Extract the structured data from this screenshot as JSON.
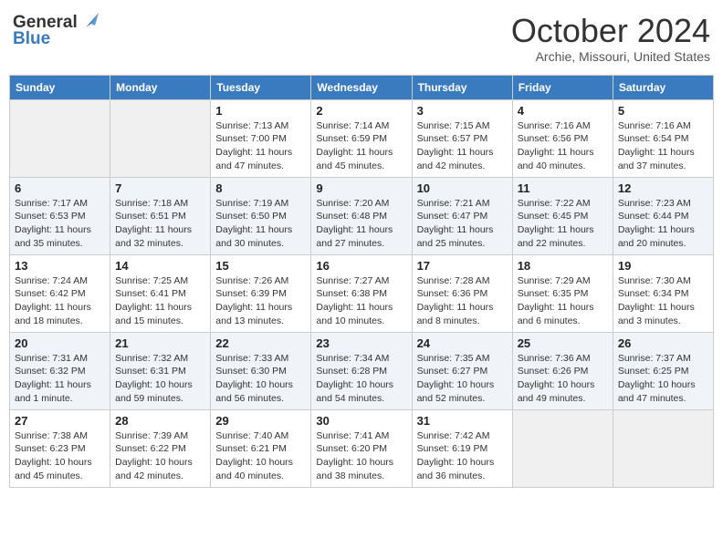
{
  "header": {
    "logo_general": "General",
    "logo_blue": "Blue",
    "month_title": "October 2024",
    "location": "Archie, Missouri, United States"
  },
  "days_of_week": [
    "Sunday",
    "Monday",
    "Tuesday",
    "Wednesday",
    "Thursday",
    "Friday",
    "Saturday"
  ],
  "weeks": [
    [
      {
        "day": "",
        "sunrise": "",
        "sunset": "",
        "daylight": ""
      },
      {
        "day": "",
        "sunrise": "",
        "sunset": "",
        "daylight": ""
      },
      {
        "day": "1",
        "sunrise": "Sunrise: 7:13 AM",
        "sunset": "Sunset: 7:00 PM",
        "daylight": "Daylight: 11 hours and 47 minutes."
      },
      {
        "day": "2",
        "sunrise": "Sunrise: 7:14 AM",
        "sunset": "Sunset: 6:59 PM",
        "daylight": "Daylight: 11 hours and 45 minutes."
      },
      {
        "day": "3",
        "sunrise": "Sunrise: 7:15 AM",
        "sunset": "Sunset: 6:57 PM",
        "daylight": "Daylight: 11 hours and 42 minutes."
      },
      {
        "day": "4",
        "sunrise": "Sunrise: 7:16 AM",
        "sunset": "Sunset: 6:56 PM",
        "daylight": "Daylight: 11 hours and 40 minutes."
      },
      {
        "day": "5",
        "sunrise": "Sunrise: 7:16 AM",
        "sunset": "Sunset: 6:54 PM",
        "daylight": "Daylight: 11 hours and 37 minutes."
      }
    ],
    [
      {
        "day": "6",
        "sunrise": "Sunrise: 7:17 AM",
        "sunset": "Sunset: 6:53 PM",
        "daylight": "Daylight: 11 hours and 35 minutes."
      },
      {
        "day": "7",
        "sunrise": "Sunrise: 7:18 AM",
        "sunset": "Sunset: 6:51 PM",
        "daylight": "Daylight: 11 hours and 32 minutes."
      },
      {
        "day": "8",
        "sunrise": "Sunrise: 7:19 AM",
        "sunset": "Sunset: 6:50 PM",
        "daylight": "Daylight: 11 hours and 30 minutes."
      },
      {
        "day": "9",
        "sunrise": "Sunrise: 7:20 AM",
        "sunset": "Sunset: 6:48 PM",
        "daylight": "Daylight: 11 hours and 27 minutes."
      },
      {
        "day": "10",
        "sunrise": "Sunrise: 7:21 AM",
        "sunset": "Sunset: 6:47 PM",
        "daylight": "Daylight: 11 hours and 25 minutes."
      },
      {
        "day": "11",
        "sunrise": "Sunrise: 7:22 AM",
        "sunset": "Sunset: 6:45 PM",
        "daylight": "Daylight: 11 hours and 22 minutes."
      },
      {
        "day": "12",
        "sunrise": "Sunrise: 7:23 AM",
        "sunset": "Sunset: 6:44 PM",
        "daylight": "Daylight: 11 hours and 20 minutes."
      }
    ],
    [
      {
        "day": "13",
        "sunrise": "Sunrise: 7:24 AM",
        "sunset": "Sunset: 6:42 PM",
        "daylight": "Daylight: 11 hours and 18 minutes."
      },
      {
        "day": "14",
        "sunrise": "Sunrise: 7:25 AM",
        "sunset": "Sunset: 6:41 PM",
        "daylight": "Daylight: 11 hours and 15 minutes."
      },
      {
        "day": "15",
        "sunrise": "Sunrise: 7:26 AM",
        "sunset": "Sunset: 6:39 PM",
        "daylight": "Daylight: 11 hours and 13 minutes."
      },
      {
        "day": "16",
        "sunrise": "Sunrise: 7:27 AM",
        "sunset": "Sunset: 6:38 PM",
        "daylight": "Daylight: 11 hours and 10 minutes."
      },
      {
        "day": "17",
        "sunrise": "Sunrise: 7:28 AM",
        "sunset": "Sunset: 6:36 PM",
        "daylight": "Daylight: 11 hours and 8 minutes."
      },
      {
        "day": "18",
        "sunrise": "Sunrise: 7:29 AM",
        "sunset": "Sunset: 6:35 PM",
        "daylight": "Daylight: 11 hours and 6 minutes."
      },
      {
        "day": "19",
        "sunrise": "Sunrise: 7:30 AM",
        "sunset": "Sunset: 6:34 PM",
        "daylight": "Daylight: 11 hours and 3 minutes."
      }
    ],
    [
      {
        "day": "20",
        "sunrise": "Sunrise: 7:31 AM",
        "sunset": "Sunset: 6:32 PM",
        "daylight": "Daylight: 11 hours and 1 minute."
      },
      {
        "day": "21",
        "sunrise": "Sunrise: 7:32 AM",
        "sunset": "Sunset: 6:31 PM",
        "daylight": "Daylight: 10 hours and 59 minutes."
      },
      {
        "day": "22",
        "sunrise": "Sunrise: 7:33 AM",
        "sunset": "Sunset: 6:30 PM",
        "daylight": "Daylight: 10 hours and 56 minutes."
      },
      {
        "day": "23",
        "sunrise": "Sunrise: 7:34 AM",
        "sunset": "Sunset: 6:28 PM",
        "daylight": "Daylight: 10 hours and 54 minutes."
      },
      {
        "day": "24",
        "sunrise": "Sunrise: 7:35 AM",
        "sunset": "Sunset: 6:27 PM",
        "daylight": "Daylight: 10 hours and 52 minutes."
      },
      {
        "day": "25",
        "sunrise": "Sunrise: 7:36 AM",
        "sunset": "Sunset: 6:26 PM",
        "daylight": "Daylight: 10 hours and 49 minutes."
      },
      {
        "day": "26",
        "sunrise": "Sunrise: 7:37 AM",
        "sunset": "Sunset: 6:25 PM",
        "daylight": "Daylight: 10 hours and 47 minutes."
      }
    ],
    [
      {
        "day": "27",
        "sunrise": "Sunrise: 7:38 AM",
        "sunset": "Sunset: 6:23 PM",
        "daylight": "Daylight: 10 hours and 45 minutes."
      },
      {
        "day": "28",
        "sunrise": "Sunrise: 7:39 AM",
        "sunset": "Sunset: 6:22 PM",
        "daylight": "Daylight: 10 hours and 42 minutes."
      },
      {
        "day": "29",
        "sunrise": "Sunrise: 7:40 AM",
        "sunset": "Sunset: 6:21 PM",
        "daylight": "Daylight: 10 hours and 40 minutes."
      },
      {
        "day": "30",
        "sunrise": "Sunrise: 7:41 AM",
        "sunset": "Sunset: 6:20 PM",
        "daylight": "Daylight: 10 hours and 38 minutes."
      },
      {
        "day": "31",
        "sunrise": "Sunrise: 7:42 AM",
        "sunset": "Sunset: 6:19 PM",
        "daylight": "Daylight: 10 hours and 36 minutes."
      },
      {
        "day": "",
        "sunrise": "",
        "sunset": "",
        "daylight": ""
      },
      {
        "day": "",
        "sunrise": "",
        "sunset": "",
        "daylight": ""
      }
    ]
  ]
}
